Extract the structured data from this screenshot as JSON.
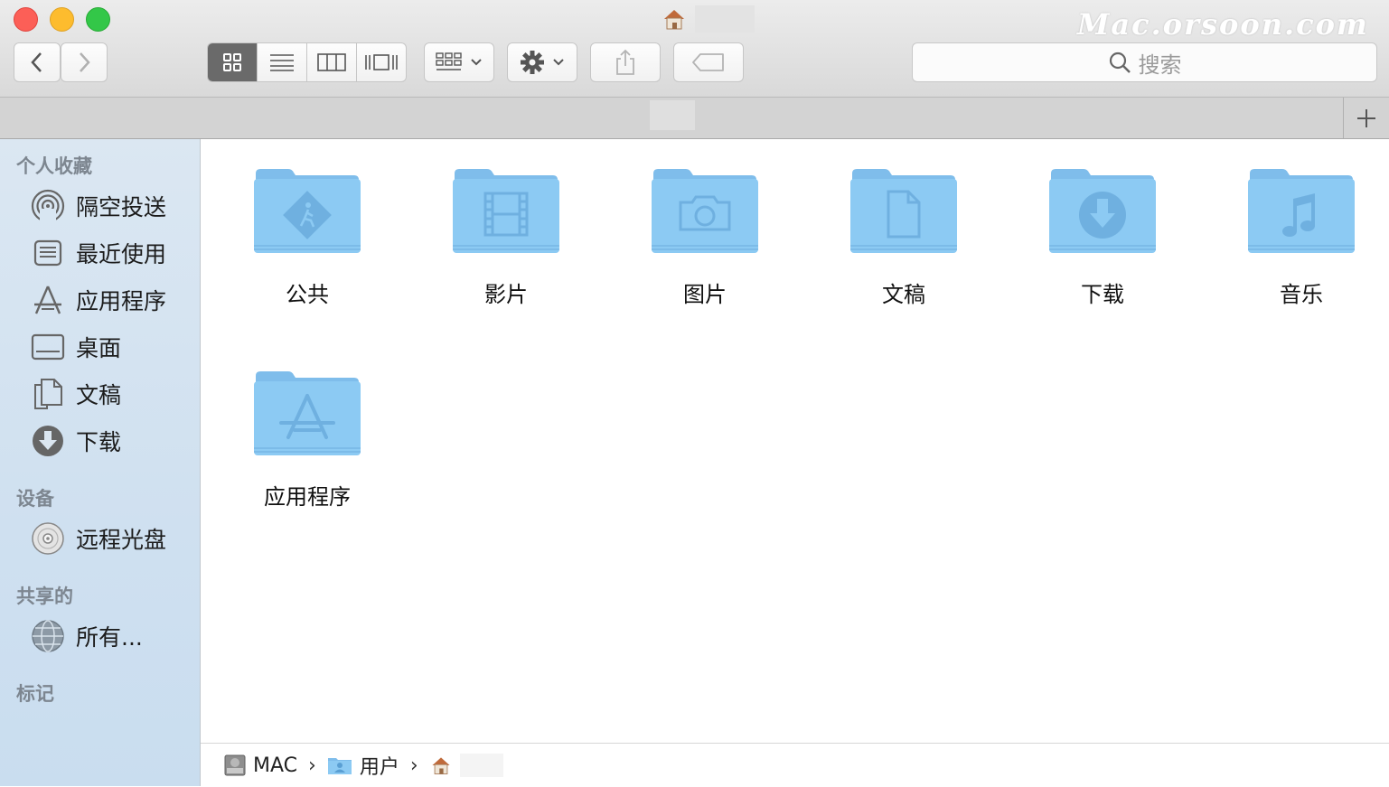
{
  "watermark": "Mac.orsoon.com",
  "toolbar": {
    "search_placeholder": "搜索",
    "view_modes": [
      "icon-view",
      "list-view",
      "column-view",
      "cover-flow-view"
    ],
    "active_view": "icon-view"
  },
  "sidebar": {
    "sections": [
      {
        "title": "个人收藏",
        "items": [
          {
            "label": "隔空投送",
            "icon": "airdrop-icon"
          },
          {
            "label": "最近使用",
            "icon": "recents-icon"
          },
          {
            "label": "应用程序",
            "icon": "applications-icon"
          },
          {
            "label": "桌面",
            "icon": "desktop-icon"
          },
          {
            "label": "文稿",
            "icon": "documents-icon"
          },
          {
            "label": "下载",
            "icon": "downloads-icon"
          }
        ]
      },
      {
        "title": "设备",
        "items": [
          {
            "label": "远程光盘",
            "icon": "remote-disc-icon"
          }
        ]
      },
      {
        "title": "共享的",
        "items": [
          {
            "label": "所有...",
            "icon": "network-icon"
          }
        ]
      },
      {
        "title": "标记",
        "items": []
      }
    ]
  },
  "folders": [
    {
      "label": "公共",
      "icon": "public-folder-icon"
    },
    {
      "label": "影片",
      "icon": "movies-folder-icon"
    },
    {
      "label": "图片",
      "icon": "pictures-folder-icon"
    },
    {
      "label": "文稿",
      "icon": "documents-folder-icon"
    },
    {
      "label": "下载",
      "icon": "downloads-folder-icon"
    },
    {
      "label": "音乐",
      "icon": "music-folder-icon"
    },
    {
      "label": "应用程序",
      "icon": "applications-folder-icon"
    }
  ],
  "pathbar": {
    "crumbs": [
      "MAC",
      "用户"
    ]
  },
  "colors": {
    "folder": "#8ccaf3",
    "folder_tab": "#7fbdeb",
    "sidebar_bg": "#d2e2f1",
    "active_segment": "#6a6a6a"
  }
}
